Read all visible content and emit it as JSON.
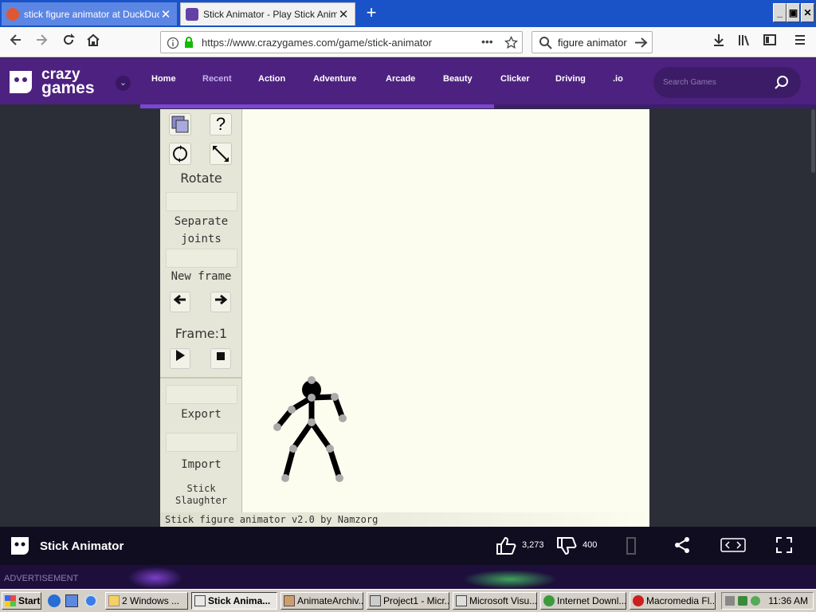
{
  "browser": {
    "tabs": [
      {
        "title": "stick figure animator at DuckDuckGo",
        "close": "✕"
      },
      {
        "title": "Stick Animator - Play Stick Animator",
        "close": "✕"
      }
    ],
    "new_tab": "+",
    "url": "https://www.crazygames.com/game/stick-animator",
    "search_value": "figure animator",
    "window_buttons": [
      "_",
      "▣",
      "✕"
    ]
  },
  "site": {
    "logo_line1": "crazy",
    "logo_line2": "games",
    "menu": [
      "Home",
      "Recent",
      "Action",
      "Adventure",
      "Arcade",
      "Beauty",
      "Clicker",
      "Driving",
      ".io"
    ],
    "search_placeholder": "Search Games"
  },
  "game": {
    "rotate_label": "Rotate",
    "help_label": "?",
    "separate_label_1": "Separate",
    "separate_label_2": "joints",
    "new_frame_label": "New frame",
    "frame_label": "Frame:1",
    "export_label": "Export",
    "import_label": "Import",
    "slaughter_label_1": "Stick",
    "slaughter_label_2": "Slaughter",
    "credit": "Stick figure animator v2.0 by Namzorg"
  },
  "gamebar": {
    "title": "Stick Animator",
    "likes": "3,273",
    "dislikes": "400"
  },
  "ad_label": "ADVERTISEMENT",
  "taskbar": {
    "start": "Start",
    "items": [
      "2 Windows ...",
      "Stick Anima...",
      "AnimateArchiv...",
      "Project1 - Micr...",
      "Microsoft Visu...",
      "Internet Downl...",
      "Macromedia Fl..."
    ],
    "clock": "11:36 AM"
  },
  "colors": {
    "brand_purple": "#4d2180",
    "accent_purple": "#7a46d4",
    "canvas_bg": "#fcfcef"
  }
}
